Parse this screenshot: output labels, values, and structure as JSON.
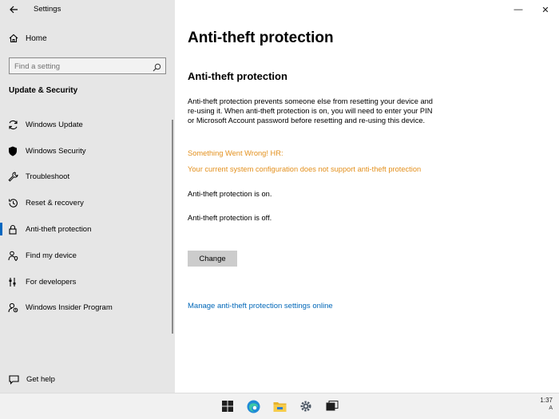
{
  "window": {
    "app_title": "Settings",
    "minimize": "—",
    "close": "✕"
  },
  "sidebar": {
    "home_label": "Home",
    "search_placeholder": "Find a setting",
    "section_title": "Update & Security",
    "items": [
      {
        "label": "Windows Update",
        "icon": "sync-icon"
      },
      {
        "label": "Windows Security",
        "icon": "shield-icon"
      },
      {
        "label": "Troubleshoot",
        "icon": "wrench-icon"
      },
      {
        "label": "Reset & recovery",
        "icon": "history-icon"
      },
      {
        "label": "Anti-theft protection",
        "icon": "lock-icon",
        "active": true
      },
      {
        "label": "Find my device",
        "icon": "person-location-icon"
      },
      {
        "label": "For developers",
        "icon": "developer-icon"
      },
      {
        "label": "Windows Insider Program",
        "icon": "insider-icon"
      }
    ],
    "help_label": "Get help"
  },
  "main": {
    "page_title": "Anti-theft protection",
    "section_title": "Anti-theft protection",
    "description": "Anti-theft protection prevents someone else from resetting your device and re-using it. When anti-theft protection is on, you will need to enter your PIN or Microsoft Account password before resetting and re-using this device.",
    "error_title": "Something Went Wrong! HR:",
    "error_message": "Your current system configuration does not support anti-theft protection",
    "status_on": "Anti-theft protection is on.",
    "status_off": "Anti-theft protection is off.",
    "change_button": "Change",
    "manage_link": "Manage anti-theft protection settings online"
  },
  "taskbar": {
    "icons": [
      "windows-start-icon",
      "edge-browser-icon",
      "file-explorer-icon",
      "settings-gear-icon",
      "task-view-icon"
    ],
    "time": "1:37",
    "lang": "A"
  },
  "colors": {
    "accent": "#0067c0",
    "link": "#0067b8",
    "warning": "#e3901d",
    "sidebar_bg": "#e6e6e6",
    "button_bg": "#cccccc"
  }
}
